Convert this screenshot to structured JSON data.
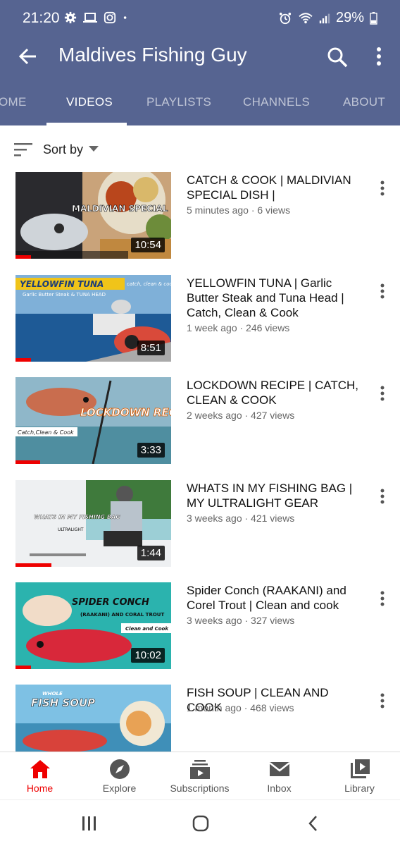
{
  "status_bar": {
    "time": "21:20",
    "battery": "29%",
    "icons": [
      "settings-icon",
      "laptop-icon",
      "instagram-icon",
      "dot-icon",
      "alarm-icon",
      "wifi-icon",
      "signal-icon",
      "battery-icon"
    ]
  },
  "app_bar": {
    "title": "Maldives Fishing Guy"
  },
  "tabs": [
    {
      "label": "HOME",
      "visible_label": "OME",
      "active": false
    },
    {
      "label": "VIDEOS",
      "visible_label": "VIDEOS",
      "active": true
    },
    {
      "label": "PLAYLISTS",
      "visible_label": "PLAYLISTS",
      "active": false
    },
    {
      "label": "CHANNELS",
      "visible_label": "CHANNELS",
      "active": false
    },
    {
      "label": "ABOUT",
      "visible_label": "ABOUT",
      "active": false
    }
  ],
  "sort": {
    "label": "Sort by"
  },
  "videos": [
    {
      "title": "CATCH & COOK | MALDIVIAN SPECIAL DISH |",
      "meta": "5 minutes ago · 6 views",
      "duration": "10:54",
      "progress": 0.1,
      "thumb_text": "MALDIVIAN SPECIAL"
    },
    {
      "title": "YELLOWFIN TUNA | Garlic Butter Steak and Tuna Head | Catch, Clean & Cook",
      "meta": "1 week ago · 246 views",
      "duration": "8:51",
      "progress": 0.1,
      "thumb_text": "YELLOWFIN TUNA",
      "thumb_subtext": "Garlic Butter Steak & TUNA HEAD",
      "thumb_corner": "catch, clean & cook"
    },
    {
      "title": "LOCKDOWN RECIPE | CATCH, CLEAN & COOK",
      "meta": "2 weeks ago · 427 views",
      "duration": "3:33",
      "progress": 0.16,
      "thumb_text": "LOCKDOWN RECIPE",
      "thumb_subtext": "Catch,Clean & Cook"
    },
    {
      "title": "WHATS IN MY FISHING BAG | MY ULTRALIGHT GEAR",
      "meta": "3 weeks ago · 421 views",
      "duration": "1:44",
      "progress": 0.23,
      "thumb_text": "WHATS IN MY FISHING BAG",
      "thumb_subtext": "ULTRALIGHT"
    },
    {
      "title": "Spider Conch (RAAKANI) and Corel Trout | Clean and cook",
      "meta": "3 weeks ago · 327 views",
      "duration": "10:02",
      "progress": 0.1,
      "thumb_text": "SPIDER CONCH",
      "thumb_subtext": "(RAAKANI) AND CORAL TROUT",
      "thumb_corner": "Clean and Cook"
    },
    {
      "title": "FISH SOUP | CLEAN AND COOK",
      "meta": "1 month ago · 468 views",
      "duration": "",
      "progress": 0,
      "thumb_text": "FISH SOUP",
      "thumb_subtext": "WHOLE"
    }
  ],
  "bottom_nav": [
    {
      "label": "Home",
      "icon": "home-icon",
      "active": true
    },
    {
      "label": "Explore",
      "icon": "compass-icon",
      "active": false
    },
    {
      "label": "Subscriptions",
      "icon": "subscriptions-icon",
      "active": false
    },
    {
      "label": "Inbox",
      "icon": "mail-icon",
      "active": false
    },
    {
      "label": "Library",
      "icon": "library-icon",
      "active": false
    }
  ],
  "colors": {
    "app_bar": "#566491",
    "accent_red": "#ee0000"
  }
}
